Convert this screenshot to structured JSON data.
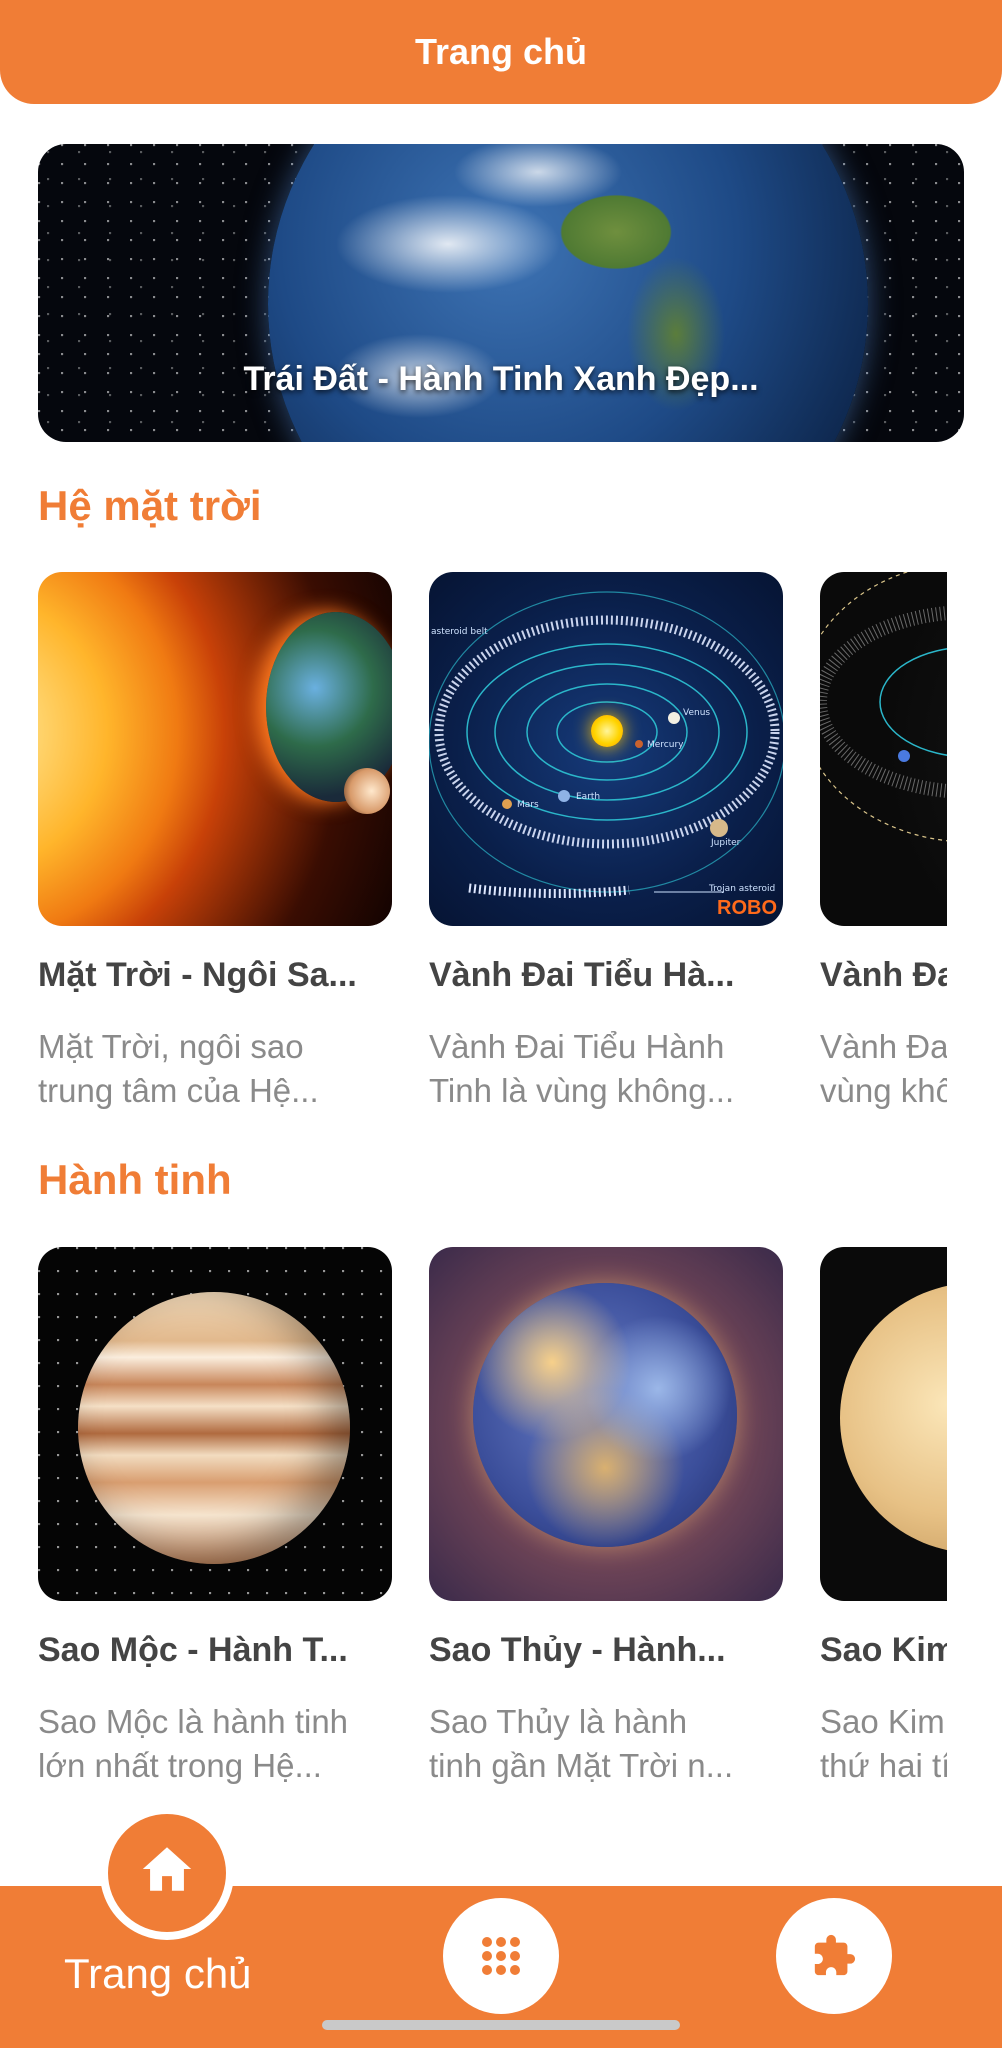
{
  "header": {
    "title": "Trang chủ"
  },
  "hero": {
    "caption": "Trái Đất - Hành Tinh Xanh Đẹp..."
  },
  "sections": [
    {
      "title": "Hệ mặt trời",
      "items": [
        {
          "title": "Mặt Trời - Ngôi Sa...",
          "desc_line1": "Mặt Trời, ngôi sao",
          "desc_line2": "trung tâm của Hệ..."
        },
        {
          "title": "Vành Đai Tiểu Hà...",
          "desc_line1": "Vành Đai Tiểu Hành",
          "desc_line2": "Tinh là vùng không...",
          "image_labels": {
            "belt": "asteroid belt",
            "venus": "Venus",
            "mercury": "Mercury",
            "earth": "Earth",
            "mars": "Mars",
            "jupiter": "Jupiter",
            "trojan": "Trojan asteroid",
            "brand": "ROBO"
          }
        },
        {
          "title": "Vành Đa",
          "desc_line1": "Vành Đa",
          "desc_line2": "vùng khô"
        }
      ]
    },
    {
      "title": "Hành tinh",
      "items": [
        {
          "title": "Sao Mộc - Hành T...",
          "desc_line1": "Sao Mộc là hành tinh",
          "desc_line2": "lớn nhất trong Hệ..."
        },
        {
          "title": "Sao Thủy - Hành...",
          "desc_line1": "Sao Thủy là hành",
          "desc_line2": "tinh gần Mặt Trời n..."
        },
        {
          "title": "Sao Kim",
          "desc_line1": "Sao Kim",
          "desc_line2": "thứ hai tí"
        }
      ]
    }
  ],
  "bottom_nav": {
    "home_label": "Trang chủ",
    "items": [
      {
        "icon": "home-icon",
        "active": true
      },
      {
        "icon": "grid-icon",
        "active": false
      },
      {
        "icon": "puzzle-icon",
        "active": false
      }
    ]
  },
  "colors": {
    "accent": "#f07d36",
    "title_text": "#444444",
    "desc_text": "#8a8a8a"
  }
}
